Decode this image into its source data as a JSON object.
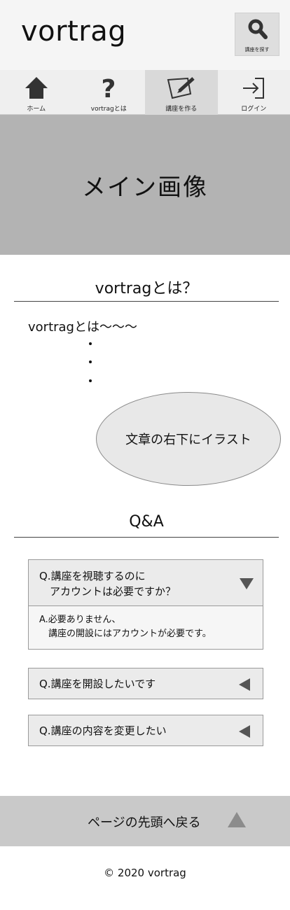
{
  "header": {
    "logo": "vortrag",
    "search_label": "講座を探す"
  },
  "nav": [
    {
      "label": "ホーム",
      "icon": "home-icon"
    },
    {
      "label": "vortragとは",
      "icon": "question-icon"
    },
    {
      "label": "講座を作る",
      "icon": "create-course-icon"
    },
    {
      "label": "ログイン",
      "icon": "login-icon"
    }
  ],
  "hero": {
    "text": "メイン画像"
  },
  "about": {
    "title": "vortragとは？",
    "text": "vortragとは〜〜〜",
    "illustration": "文章の右下にイラスト"
  },
  "faq": {
    "title": "Q&A",
    "items": [
      {
        "q_line1": "Q.講座を視聴するのに",
        "q_line2": "　アカウントは必要ですか？",
        "a_line1": "A.必要ありません、",
        "a_line2": "　講座の開設にはアカウントが必要です。",
        "expanded": true
      },
      {
        "q_line1": "Q.講座を開設したいです",
        "expanded": false
      },
      {
        "q_line1": "Q.講座の内容を変更したい",
        "expanded": false
      }
    ]
  },
  "back_to_top": {
    "label": "ページの先頭へ戻る"
  },
  "footer": {
    "copyright": "© 2020 vortrag"
  },
  "colors": {
    "header_bg": "#f5f5f5",
    "hero_bg": "#b3b3b3",
    "nav_active": "#d9d9d9",
    "back_to_top_bg": "#c9c9c9",
    "arrow": "#555555"
  }
}
